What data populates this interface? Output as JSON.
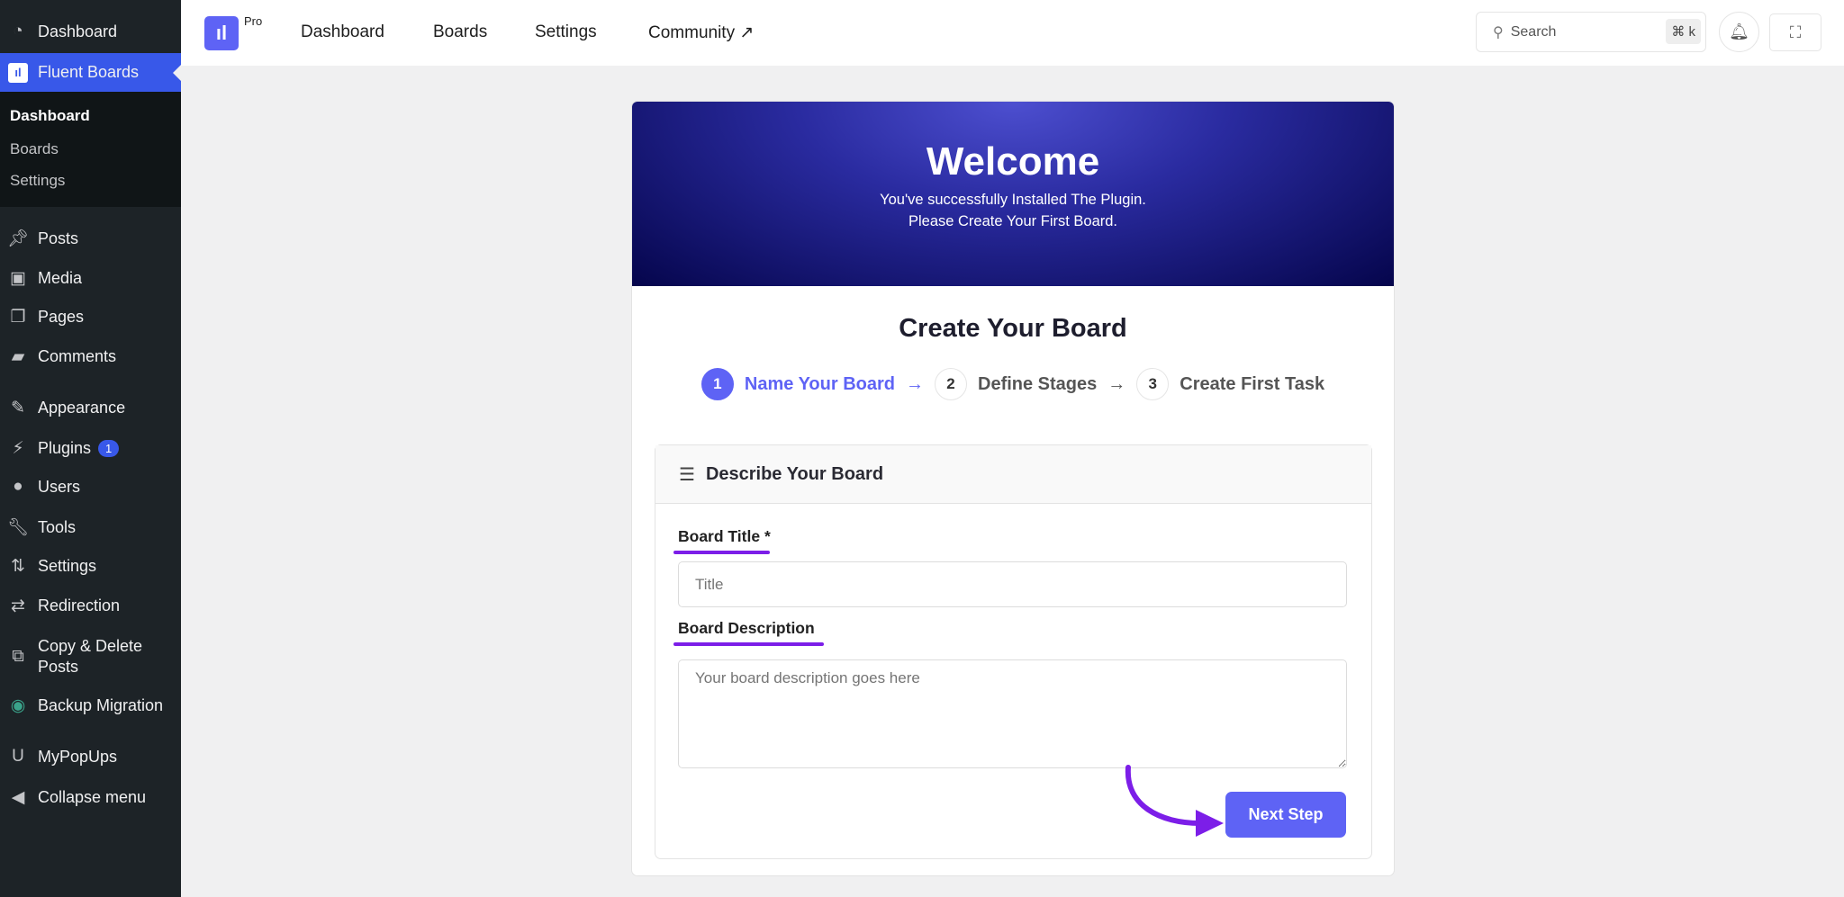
{
  "sidebar": {
    "top_item": "Dashboard",
    "active_item": "Fluent Boards",
    "submenu": [
      "Dashboard",
      "Boards",
      "Settings"
    ],
    "items": [
      {
        "label": "Posts",
        "icon": "pin-icon"
      },
      {
        "label": "Media",
        "icon": "media-icon"
      },
      {
        "label": "Pages",
        "icon": "pages-icon"
      },
      {
        "label": "Comments",
        "icon": "comment-icon"
      },
      {
        "label": "Appearance",
        "icon": "brush-icon"
      },
      {
        "label": "Plugins",
        "icon": "plug-icon",
        "badge": "1"
      },
      {
        "label": "Users",
        "icon": "user-icon"
      },
      {
        "label": "Tools",
        "icon": "wrench-icon"
      },
      {
        "label": "Settings",
        "icon": "settings-icon"
      },
      {
        "label": "Redirection",
        "icon": "redirect-icon"
      },
      {
        "label": "Copy & Delete Posts",
        "icon": "copy-icon"
      },
      {
        "label": "Backup Migration",
        "icon": "backup-icon"
      },
      {
        "label": "MyPopUps",
        "icon": "popup-icon"
      },
      {
        "label": "Collapse menu",
        "icon": "collapse-icon"
      }
    ]
  },
  "topbar": {
    "pro_label": "Pro",
    "nav": [
      "Dashboard",
      "Boards",
      "Settings",
      "Community ↗"
    ],
    "search_placeholder": "Search",
    "shortcut": "⌘ k"
  },
  "hero": {
    "title": "Welcome",
    "line1": "You've successfully Installed The Plugin.",
    "line2": "Please Create Your First Board."
  },
  "wizard": {
    "title": "Create Your Board",
    "steps": [
      {
        "num": "1",
        "label": "Name Your Board"
      },
      {
        "num": "2",
        "label": "Define Stages"
      },
      {
        "num": "3",
        "label": "Create First Task"
      }
    ],
    "section_title": "Describe Your Board",
    "title_label": "Board Title *",
    "title_placeholder": "Title",
    "desc_label": "Board Description",
    "desc_placeholder": "Your board description goes here",
    "next_label": "Next Step"
  },
  "colors": {
    "accent": "#5e63f5",
    "wp_blue": "#3858e9",
    "annotation": "#7c1ee8"
  }
}
